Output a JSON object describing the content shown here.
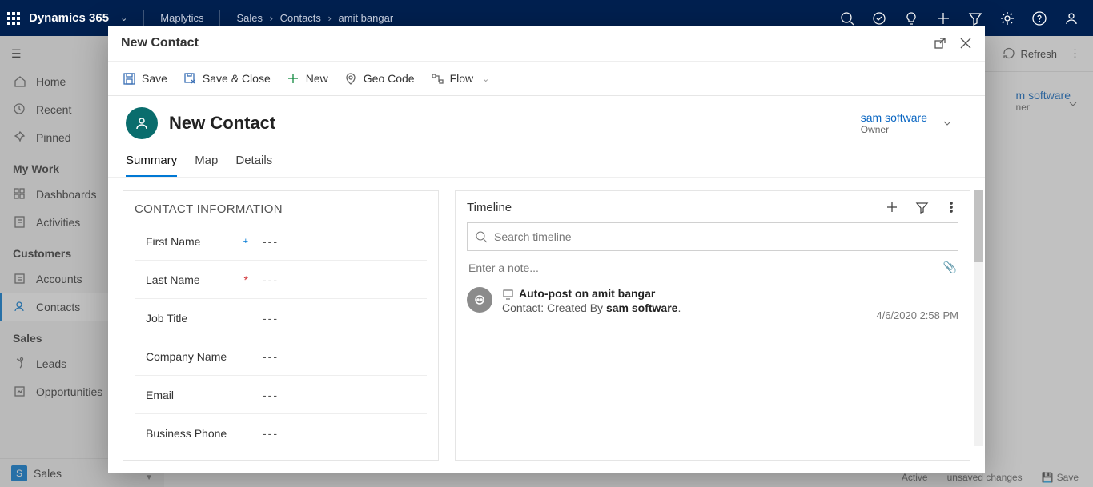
{
  "topbar": {
    "brand": "Dynamics 365",
    "app": "Maplytics",
    "crumbs": [
      "Sales",
      "Contacts",
      "amit bangar"
    ]
  },
  "sidebar": {
    "items": [
      {
        "label": "Home"
      },
      {
        "label": "Recent"
      },
      {
        "label": "Pinned"
      }
    ],
    "groups": [
      {
        "heading": "My Work",
        "items": [
          "Dashboards",
          "Activities"
        ]
      },
      {
        "heading": "Customers",
        "items": [
          "Accounts",
          "Contacts"
        ]
      },
      {
        "heading": "Sales",
        "items": [
          "Leads",
          "Opportunities"
        ]
      }
    ],
    "footer": {
      "badge": "S",
      "label": "Sales"
    }
  },
  "bg_page": {
    "refresh": "Refresh",
    "owner": {
      "name": "m software",
      "sub": "ner"
    },
    "status": "Active",
    "unsaved": "unsaved changes",
    "save": "Save"
  },
  "modal": {
    "title": "New Contact",
    "cmd": {
      "save": "Save",
      "save_close": "Save & Close",
      "new": "New",
      "geo": "Geo Code",
      "flow": "Flow"
    },
    "record_title": "New Contact",
    "owner": {
      "name": "sam software",
      "sub": "Owner"
    },
    "tabs": [
      "Summary",
      "Map",
      "Details"
    ],
    "contact_info": {
      "heading": "CONTACT INFORMATION",
      "fields": {
        "first_name": {
          "label": "First Name",
          "value": "---",
          "indicator": "rec"
        },
        "last_name": {
          "label": "Last Name",
          "value": "---",
          "indicator": "req"
        },
        "job_title": {
          "label": "Job Title",
          "value": "---"
        },
        "company_name": {
          "label": "Company Name",
          "value": "---"
        },
        "email": {
          "label": "Email",
          "value": "---"
        },
        "business_phone": {
          "label": "Business Phone",
          "value": "---"
        }
      }
    },
    "timeline": {
      "heading": "Timeline",
      "search_placeholder": "Search timeline",
      "note_placeholder": "Enter a note...",
      "post": {
        "title": "Auto-post on amit bangar",
        "prefix": "Contact: Created By ",
        "author": "sam software",
        "date": "4/6/2020 2:58 PM"
      }
    }
  }
}
